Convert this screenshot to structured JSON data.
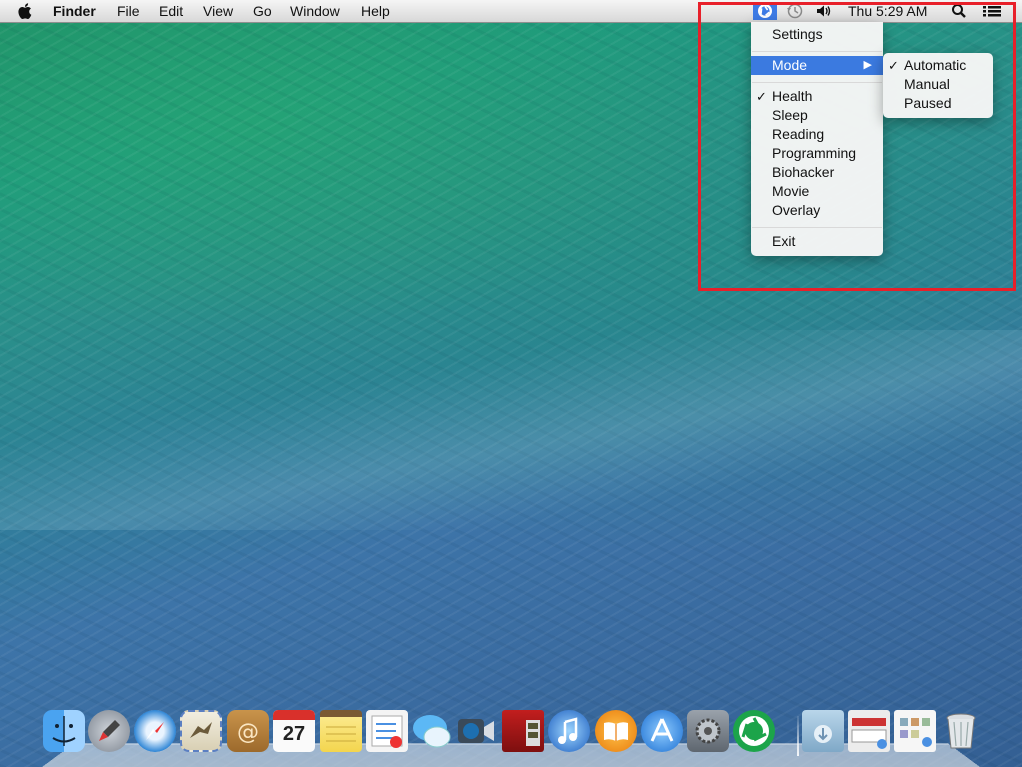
{
  "menubar": {
    "apple_icon": "apple-icon",
    "app_name": "Finder",
    "menus": [
      "File",
      "Edit",
      "View",
      "Go",
      "Window",
      "Help"
    ],
    "status_icons": [
      "app-aperture-icon",
      "time-machine-icon",
      "volume-icon"
    ],
    "clock": "Thu 5:29 AM",
    "spotlight_icon": "search-icon",
    "notification_icon": "notification-center-icon"
  },
  "app_menu": {
    "items": {
      "settings": "Settings",
      "mode": "Mode",
      "health": "Health",
      "sleep": "Sleep",
      "reading": "Reading",
      "programming": "Programming",
      "biohacker": "Biohacker",
      "movie": "Movie",
      "overlay": "Overlay",
      "exit": "Exit"
    },
    "checked": "Health",
    "highlighted": "Mode"
  },
  "mode_submenu": {
    "items": {
      "automatic": "Automatic",
      "manual": "Manual",
      "paused": "Paused"
    },
    "checked": "Automatic"
  },
  "dock": {
    "calendar_date": "27",
    "apps": [
      "finder",
      "launchpad",
      "safari",
      "mail",
      "contacts",
      "calendar",
      "notes",
      "reminders",
      "messages",
      "facetime",
      "photo-booth",
      "itunes",
      "ibooks",
      "app-store",
      "system-preferences",
      "aperture-app",
      "downloads",
      "documents",
      "applications",
      "trash"
    ]
  },
  "colors": {
    "highlight_border": "#e8202a",
    "menu_selection": "#3b7ae0"
  }
}
